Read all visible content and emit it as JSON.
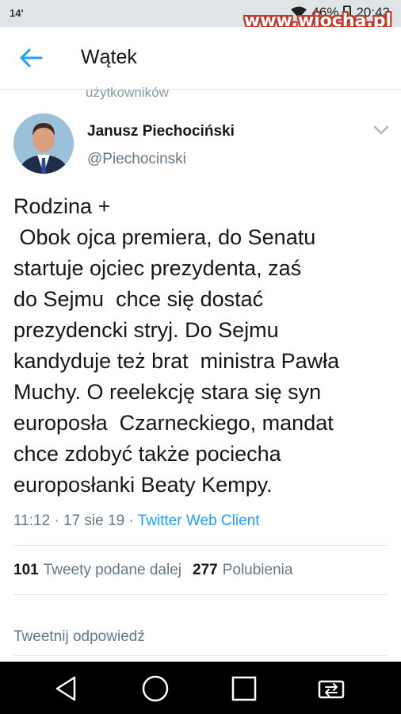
{
  "status_bar": {
    "left_text": "14'",
    "battery": "46%",
    "time": "20:42",
    "watermark": "www.wiocha.pl"
  },
  "app_bar": {
    "title": "Wątek",
    "back_icon": "arrow-left-icon"
  },
  "cut_text": "użytkowników",
  "tweet": {
    "author_name": "Janusz Piechociński",
    "author_handle": "@Piechocinski",
    "text": "Rodzina +\n Obok ojca premiera, do Senatu\nstartuje ojciec prezydenta, zaś\ndo Sejmu  chce się dostać\nprezydencki stryj. Do Sejmu\nkandyduje też brat  ministra Pawła\nMuchy. O reelekcję stara się syn\neuroposła  Czarneckiego, mandat\nchce zdobyć także pociecha\neuroposłanki Beaty Kempy.",
    "timestamp": "11:12 · 17 sie 19 · ",
    "client": "Twitter Web Client",
    "retweet_count": "101",
    "retweet_label": "Tweety podane dalej",
    "like_count": "277",
    "like_label": "Polubienia"
  },
  "reply_placeholder": "Tweetnij odpowiedź",
  "colors": {
    "accent": "#1da1f2",
    "secondary_text": "#657786",
    "status_bar_bg": "#e1e4e6",
    "nav_bar_bg": "#000000"
  },
  "nav_icons": [
    "back-triangle-icon",
    "home-circle-icon",
    "recents-square-icon",
    "switch-app-icon"
  ]
}
